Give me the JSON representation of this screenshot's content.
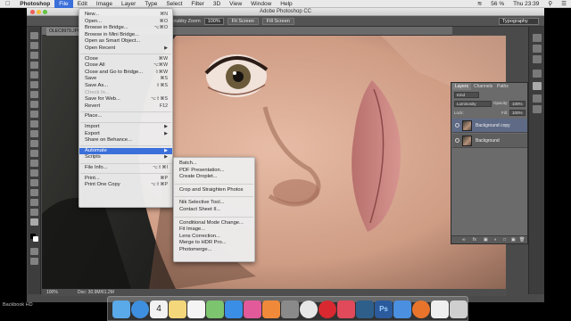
{
  "macbar": {
    "apple_icon": "apple-logo-icon",
    "app": "Photoshop",
    "menus": [
      "File",
      "Edit",
      "Image",
      "Layer",
      "Type",
      "Select",
      "Filter",
      "3D",
      "View",
      "Window",
      "Help"
    ],
    "battery": "56 %",
    "clock": "Thu 23:39"
  },
  "window": {
    "title": "Adobe Photoshop CC"
  },
  "options_bar": {
    "scrubby_zoom": "Scrubby Zoom",
    "zoom_value": "100%",
    "fit_screen": "Fit Screen",
    "fill_screen": "Fill Screen",
    "workspace": "Typography"
  },
  "document": {
    "tab_label": "OLEC9979.JPG",
    "zoom": "100%",
    "doc_info": "Doc: 30.9M/61.2M"
  },
  "file_menu": {
    "items": [
      {
        "label": "New...",
        "shortcut": "⌘N",
        "enabled": true
      },
      {
        "label": "Open...",
        "shortcut": "⌘O",
        "enabled": true
      },
      {
        "label": "Browse in Bridge...",
        "shortcut": "⌥⌘O",
        "enabled": true
      },
      {
        "label": "Browse in Mini Bridge...",
        "shortcut": "",
        "enabled": true
      },
      {
        "label": "Open as Smart Object...",
        "shortcut": "",
        "enabled": true
      },
      {
        "label": "Open Recent",
        "shortcut": "",
        "enabled": true,
        "submenu": true
      },
      {
        "label": "Close",
        "shortcut": "⌘W",
        "enabled": true
      },
      {
        "label": "Close All",
        "shortcut": "⌥⌘W",
        "enabled": true
      },
      {
        "label": "Close and Go to Bridge...",
        "shortcut": "⇧⌘W",
        "enabled": true
      },
      {
        "label": "Save",
        "shortcut": "⌘S",
        "enabled": true
      },
      {
        "label": "Save As...",
        "shortcut": "⇧⌘S",
        "enabled": true
      },
      {
        "label": "Check In...",
        "shortcut": "",
        "enabled": false
      },
      {
        "label": "Save for Web...",
        "shortcut": "⌥⇧⌘S",
        "enabled": true
      },
      {
        "label": "Revert",
        "shortcut": "F12",
        "enabled": true
      },
      {
        "label": "Place...",
        "shortcut": "",
        "enabled": true
      },
      {
        "label": "Import",
        "shortcut": "",
        "enabled": true,
        "submenu": true
      },
      {
        "label": "Export",
        "shortcut": "",
        "enabled": true,
        "submenu": true
      },
      {
        "label": "Share on Behance...",
        "shortcut": "",
        "enabled": true
      },
      {
        "label": "Automate",
        "shortcut": "",
        "enabled": true,
        "submenu": true,
        "highlighted": true
      },
      {
        "label": "Scripts",
        "shortcut": "",
        "enabled": true,
        "submenu": true
      },
      {
        "label": "File Info...",
        "shortcut": "⌥⇧⌘I",
        "enabled": true
      },
      {
        "label": "Print...",
        "shortcut": "⌘P",
        "enabled": true
      },
      {
        "label": "Print One Copy",
        "shortcut": "⌥⇧⌘P",
        "enabled": true
      }
    ]
  },
  "automate_menu": {
    "items": [
      {
        "label": "Batch..."
      },
      {
        "label": "PDF Presentation..."
      },
      {
        "label": "Create Droplet..."
      },
      {
        "label": "Crop and Straighten Photos"
      },
      {
        "label": "Nik Selective Tool..."
      },
      {
        "label": "Contact Sheet II..."
      },
      {
        "label": "Conditional Mode Change..."
      },
      {
        "label": "Fit Image..."
      },
      {
        "label": "Lens Correction..."
      },
      {
        "label": "Merge to HDR Pro..."
      },
      {
        "label": "Photomerge..."
      }
    ]
  },
  "layers_panel": {
    "tabs": [
      "Layers",
      "Channels",
      "Paths"
    ],
    "kind_filter": "Kind",
    "blend_mode": "Luminosity",
    "opacity_label": "Opacity:",
    "opacity": "100%",
    "lock_label": "Lock:",
    "fill_label": "Fill:",
    "fill": "100%",
    "layers": [
      {
        "name": "Background copy",
        "selected": true
      },
      {
        "name": "Background",
        "selected": false
      }
    ]
  },
  "dock": {
    "icons": [
      "finder-icon",
      "safari-icon",
      "calendar-icon",
      "notes-icon",
      "reminders-icon",
      "maps-icon",
      "app-store-icon",
      "itunes-icon",
      "ibooks-icon",
      "system-preferences-icon",
      "chrome-icon",
      "opera-icon",
      "skitch-icon",
      "lightroom-icon",
      "photoshop-icon",
      "mail-icon",
      "firefox-icon",
      "file-icon",
      "trash-icon"
    ],
    "calendar_day": "4"
  },
  "watermark": "Backbook HD"
}
